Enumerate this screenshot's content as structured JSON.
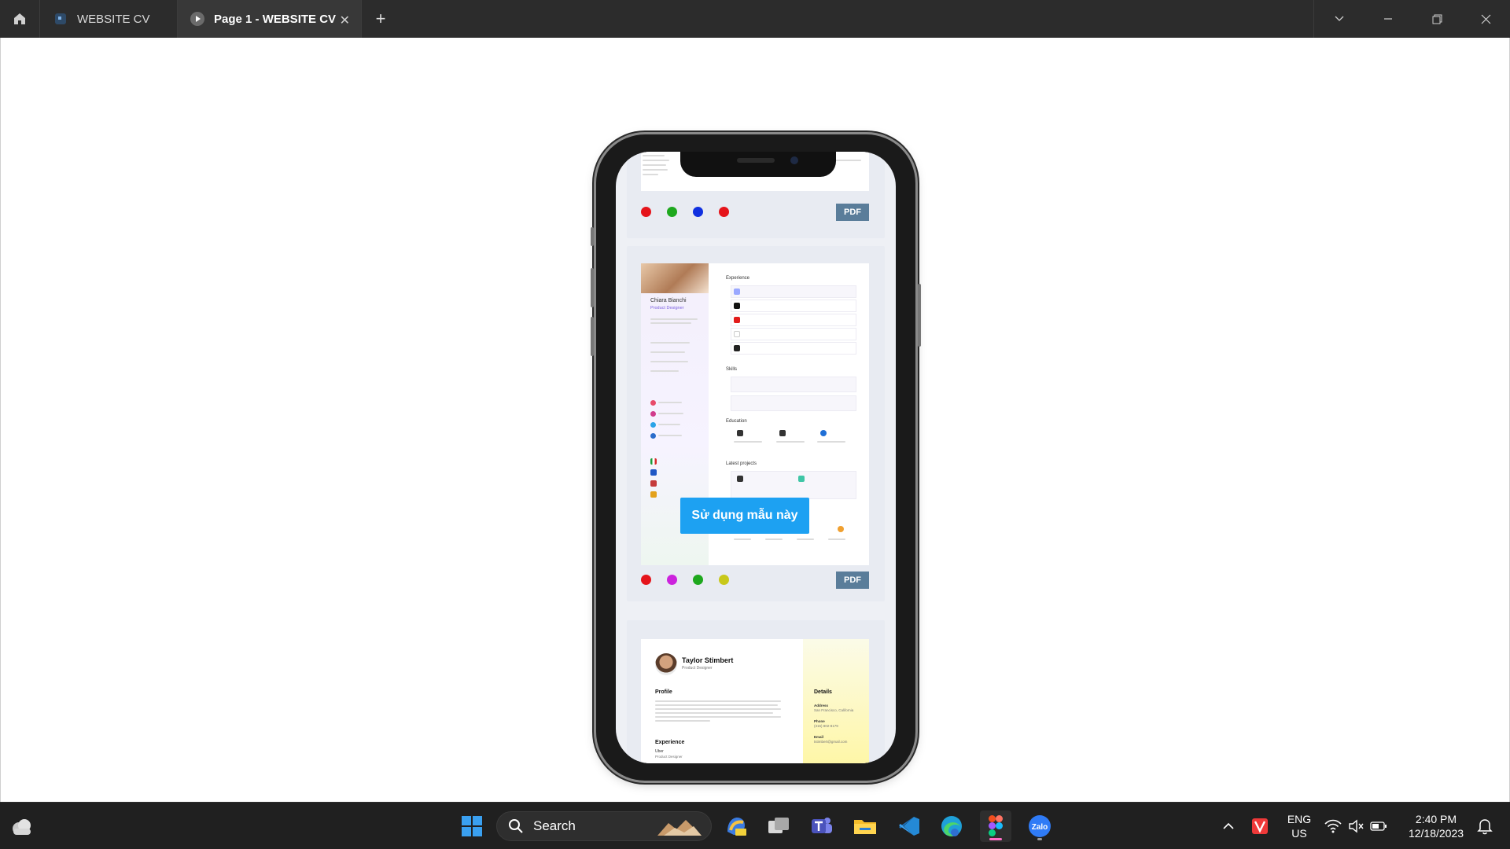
{
  "titlebar": {
    "tabs": [
      {
        "label": "WEBSITE CV"
      },
      {
        "label": "Page 1 - WEBSITE CV"
      }
    ],
    "close_glyph": "✕",
    "new_tab_glyph": "+"
  },
  "phone": {
    "cards": [
      {
        "dots": [
          "#e5141b",
          "#1ea81e",
          "#1030e0",
          "#e5141b"
        ],
        "pdf_label": "PDF"
      },
      {
        "cv": {
          "name": "Chiara Bianchi",
          "role": "Product Designer",
          "sections": [
            "Experience",
            "Skills",
            "Education",
            "Latest projects"
          ]
        },
        "cta_label": "Sử dụng mẫu này",
        "dots": [
          "#e5141b",
          "#cc22dd",
          "#1ea81e",
          "#c8c81a"
        ],
        "pdf_label": "PDF"
      },
      {
        "cv": {
          "name": "Taylor Stimbert",
          "role": "Product Designer",
          "profile_title": "Profile",
          "experience_title": "Experience",
          "experience_company": "Uber",
          "experience_role": "Product Designer",
          "details_title": "Details",
          "details": [
            {
              "label": "Address",
              "value": "San Francisco, California"
            },
            {
              "label": "Phone",
              "value": "(315) 802-8179"
            },
            {
              "label": "Email",
              "value": "tstimbert@gmail.com"
            }
          ]
        }
      }
    ]
  },
  "taskbar": {
    "search_label": "Search",
    "language_top": "ENG",
    "language_bottom": "US",
    "time": "2:40 PM",
    "date": "12/18/2023",
    "accent_colors": {
      "windows": "#3aa0f0",
      "active_app": "#ff6ec7"
    }
  }
}
